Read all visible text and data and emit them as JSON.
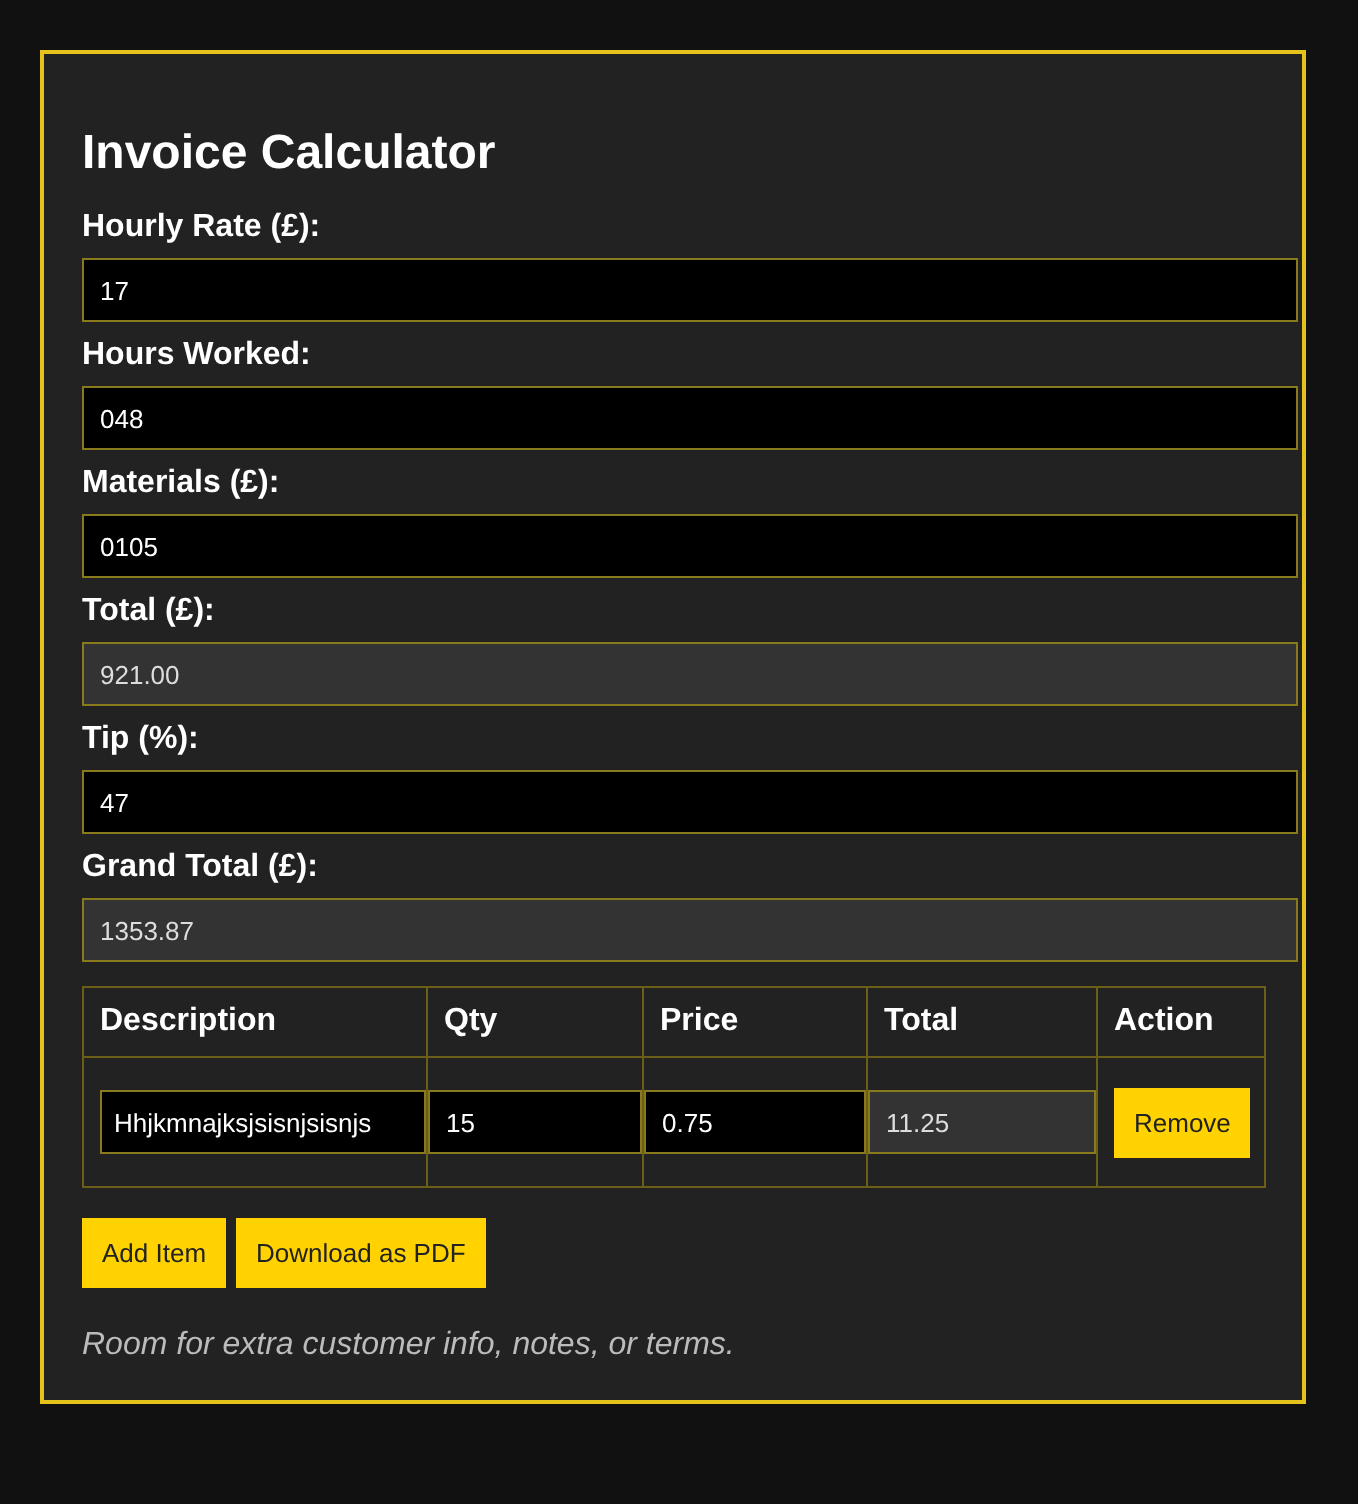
{
  "title": "Invoice Calculator",
  "fields": [
    {
      "label": "Hourly Rate (£):",
      "value": "17",
      "readonly": false
    },
    {
      "label": "Hours Worked:",
      "value": "048",
      "readonly": false
    },
    {
      "label": "Materials (£):",
      "value": "0105",
      "readonly": false
    },
    {
      "label": "Total (£):",
      "value": "921.00",
      "readonly": true
    },
    {
      "label": "Tip (%):",
      "value": "47",
      "readonly": false
    },
    {
      "label": "Grand Total (£):",
      "value": "1353.87",
      "readonly": true
    }
  ],
  "table": {
    "columns": [
      "Description",
      "Qty",
      "Price",
      "Total",
      "Action"
    ],
    "rows": [
      {
        "description": "Hhjkmnajksjsisnjsisnjs",
        "qty": "15",
        "price": "0.75",
        "total": "11.25",
        "action": "Remove"
      }
    ]
  },
  "buttons": [
    "Add Item",
    "Download as PDF"
  ],
  "note": "Room for extra customer info, notes, or terms."
}
